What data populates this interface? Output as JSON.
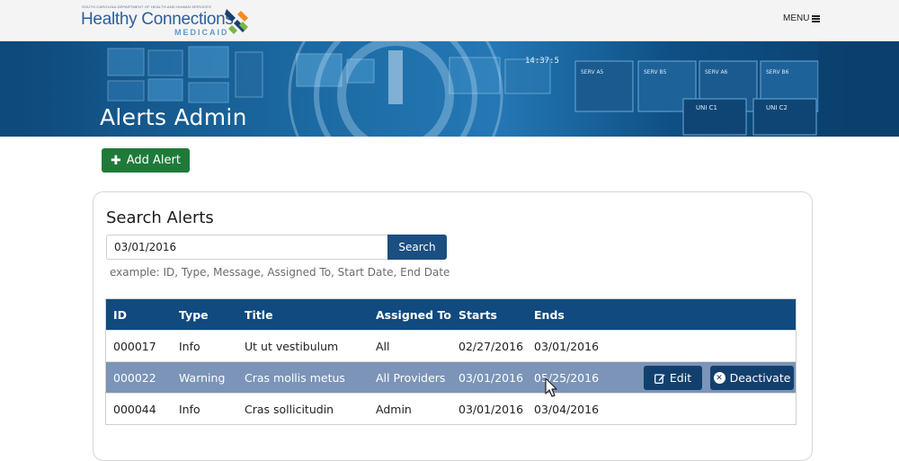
{
  "header": {
    "logo_department": "SOUTH CAROLINA DEPARTMENT OF HEALTH AND HUMAN SERVICES",
    "logo_main": "Healthy Connections",
    "logo_sub": "MEDICAID",
    "menu_label": "MENU",
    "menu_icon": "hamburger-icon"
  },
  "banner": {
    "title": "Alerts Admin",
    "screen_labels": [
      "SERV A5",
      "SERV B5",
      "SERV A6",
      "SERV B6",
      "UNI C1",
      "UNI C2"
    ],
    "clock": "14:37:5"
  },
  "actions": {
    "add_alert_icon": "plus-icon",
    "add_alert_label": "Add Alert"
  },
  "search": {
    "title": "Search Alerts",
    "input_value": "03/01/2016",
    "button_label": "Search",
    "hint": "example: ID, Type, Message, Assigned To, Start Date, End Date"
  },
  "table": {
    "columns": [
      "ID",
      "Type",
      "Title",
      "Assigned To",
      "Starts",
      "Ends"
    ],
    "rows": [
      {
        "id": "000017",
        "type": "Info",
        "title": "Ut ut vestibulum",
        "assigned": "All",
        "starts": "02/27/2016",
        "ends": "03/01/2016",
        "selected": false
      },
      {
        "id": "000022",
        "type": "Warning",
        "title": "Cras mollis metus",
        "assigned": "All Providers",
        "starts": "03/01/2016",
        "ends": "05/25/2016",
        "selected": true
      },
      {
        "id": "000044",
        "type": "Info",
        "title": "Cras sollicitudin",
        "assigned": "Admin",
        "starts": "03/01/2016",
        "ends": "03/04/2016",
        "selected": false
      }
    ],
    "row_actions": {
      "edit_label": "Edit",
      "edit_icon": "edit-icon",
      "deactivate_label": "Deactivate",
      "deactivate_icon": "close-circle-icon"
    }
  },
  "colors": {
    "brand_blue": "#104a7e",
    "add_green": "#1f7a3a",
    "selected_row": "#7b94b8",
    "logo_orange": "#f28c1e",
    "logo_green": "#7ab648"
  }
}
